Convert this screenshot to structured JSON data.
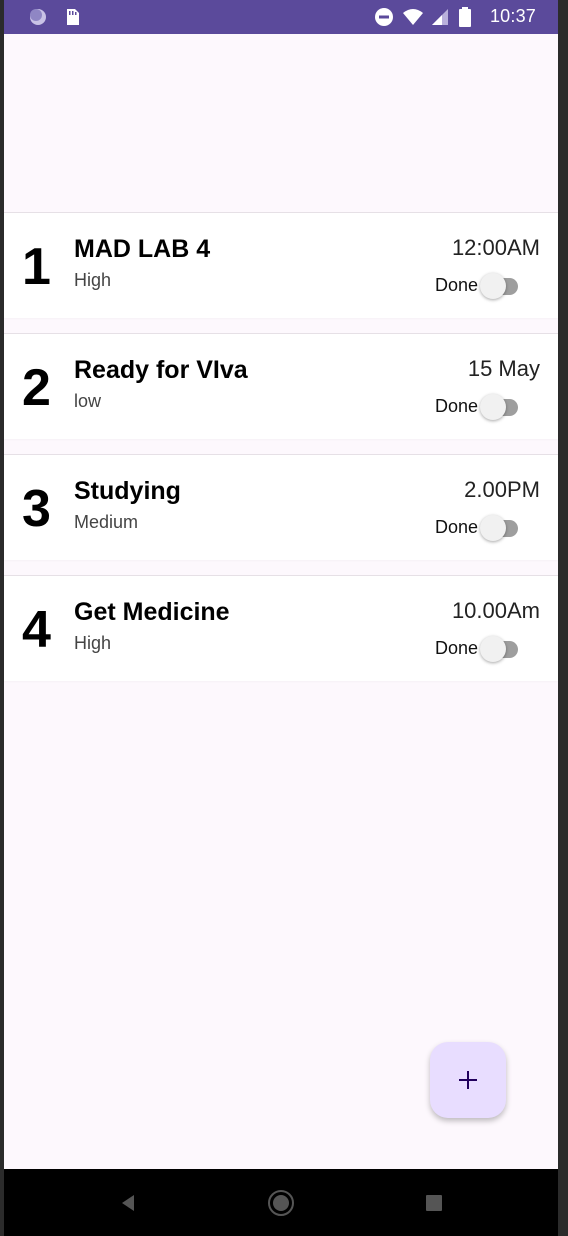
{
  "statusbar": {
    "time": "10:37",
    "left_icons": [
      "circle-app-icon",
      "sd-card-icon"
    ],
    "right_icons": [
      "do-not-disturb-icon",
      "wifi-icon",
      "signal-icon",
      "battery-icon"
    ],
    "background": "#5b4a9b"
  },
  "tasks": [
    {
      "number": "1",
      "title": "MAD LAB 4",
      "priority": "High",
      "time": "12:00AM",
      "done_label": "Done",
      "done": false
    },
    {
      "number": "2",
      "title": "Ready for VIva",
      "priority": "low",
      "time": "15 May",
      "done_label": "Done",
      "done": false
    },
    {
      "number": "3",
      "title": "Studying",
      "priority": "Medium",
      "time": "2.00PM",
      "done_label": "Done",
      "done": false
    },
    {
      "number": "4",
      "title": "Get Medicine",
      "priority": "High",
      "time": "10.00Am",
      "done_label": "Done",
      "done": false
    }
  ],
  "fab": {
    "icon": "plus-icon",
    "color": "#e8ddff"
  },
  "navbar": {
    "icons": [
      "back-icon",
      "home-icon",
      "recents-icon"
    ]
  }
}
